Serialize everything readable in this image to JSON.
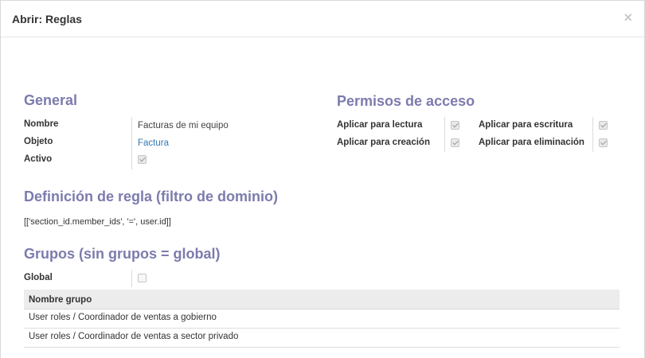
{
  "dialog": {
    "title": "Abrir: Reglas",
    "close_symbol": "×"
  },
  "general": {
    "heading": "General",
    "fields": {
      "name_label": "Nombre",
      "name_value": "Facturas de mi equipo",
      "object_label": "Objeto",
      "object_value": "Factura",
      "active_label": "Activo",
      "active_checked": true
    }
  },
  "access": {
    "heading": "Permisos de acceso",
    "read_label": "Aplicar para lectura",
    "read_checked": true,
    "create_label": "Aplicar para creación",
    "create_checked": true,
    "write_label": "Aplicar para escritura",
    "write_checked": true,
    "unlink_label": "Aplicar para eliminación",
    "unlink_checked": true
  },
  "rule_definition": {
    "heading": "Definición de regla (filtro de dominio)",
    "domain": "[['section_id.member_ids', '=', user.id]]"
  },
  "groups": {
    "heading": "Grupos (sin grupos = global)",
    "global_label": "Global",
    "global_checked": false,
    "table": {
      "column_header": "Nombre grupo",
      "rows": [
        "User roles / Coordinador de ventas a gobierno",
        "User roles / Coordinador de ventas a sector privado"
      ]
    }
  }
}
